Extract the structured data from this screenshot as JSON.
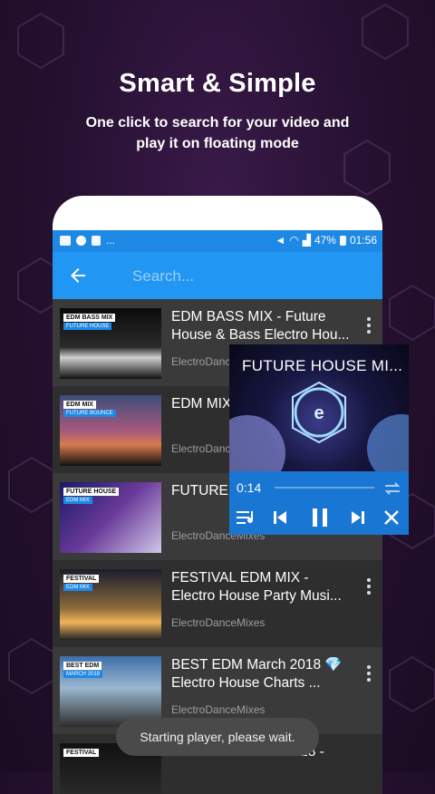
{
  "promo": {
    "title": "Smart & Simple",
    "subtitle_line1": "One click to search for your video and",
    "subtitle_line2": "play it on floating mode"
  },
  "statusbar": {
    "battery": "47%",
    "time": "01:56",
    "more": "..."
  },
  "search": {
    "placeholder": "Search..."
  },
  "videos": [
    {
      "title": "EDM BASS MIX - Future House & Bass Electro Hou...",
      "channel": "ElectroDanceMixes",
      "thumb_tag": "EDM BASS MIX",
      "thumb_tag2": "FUTURE HOUSE"
    },
    {
      "title": "EDM MIX Bounce &",
      "channel": "ElectroDanceMixes",
      "thumb_tag": "EDM MIX",
      "thumb_tag2": "FUTURE BOUNCE"
    },
    {
      "title": "FUTURE H Electro H",
      "channel": "ElectroDanceMixes",
      "thumb_tag": "FUTURE HOUSE",
      "thumb_tag2": "EDM MIX"
    },
    {
      "title": "FESTIVAL EDM MIX - Electro House Party Musi...",
      "channel": "ElectroDanceMixes",
      "thumb_tag": "FESTIVAL",
      "thumb_tag2": "EDM MIX"
    },
    {
      "title": "BEST EDM March 2018 💎 Electro House Charts ...",
      "channel": "ElectroDanceMixes",
      "thumb_tag": "BEST EDM",
      "thumb_tag2": "MARCH 2018"
    },
    {
      "title": "Festival EDM Mix 2018 -",
      "channel": "",
      "thumb_tag": "FESTIVAL",
      "thumb_tag2": ""
    }
  ],
  "player": {
    "title": "FUTURE HOUSE MI...",
    "time": "0:14",
    "icons": [
      "repeat-icon",
      "playlist-icon",
      "previous-icon",
      "pause-icon",
      "next-icon",
      "close-icon"
    ]
  },
  "toast": "Starting player, please wait.",
  "colors": {
    "appbar": "#2196f3",
    "statusbar": "#1e88e5",
    "player_controls": "#1976d2",
    "list_bg": "#2d2d2d"
  }
}
